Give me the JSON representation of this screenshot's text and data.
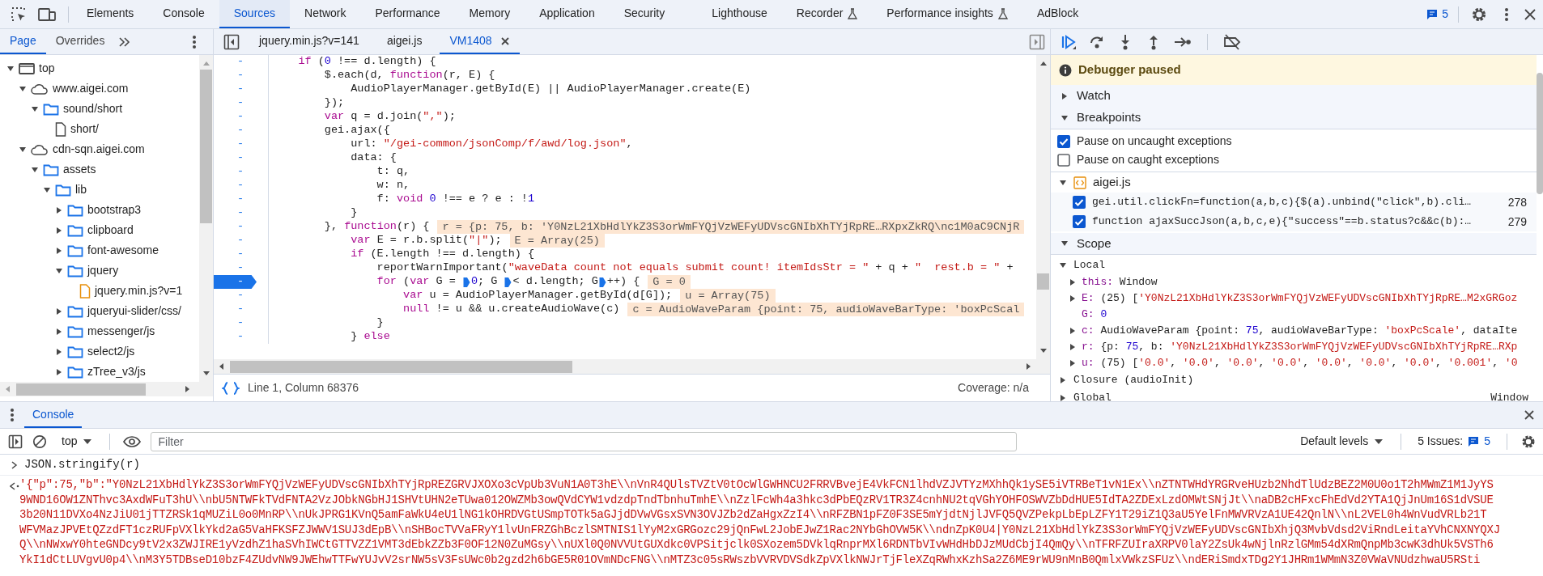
{
  "toolbar": {
    "tabs": [
      {
        "label": "Elements",
        "selected": false,
        "experimental": false
      },
      {
        "label": "Console",
        "selected": false,
        "experimental": false
      },
      {
        "label": "Sources",
        "selected": true,
        "experimental": false
      },
      {
        "label": "Network",
        "selected": false,
        "experimental": false
      },
      {
        "label": "Performance",
        "selected": false,
        "experimental": false
      },
      {
        "label": "Memory",
        "selected": false,
        "experimental": false
      },
      {
        "label": "Application",
        "selected": false,
        "experimental": false
      },
      {
        "label": "Security",
        "selected": false,
        "experimental": false
      },
      {
        "label": "Lighthouse",
        "selected": false,
        "experimental": false
      },
      {
        "label": "Recorder",
        "selected": false,
        "experimental": true
      },
      {
        "label": "Performance insights",
        "selected": false,
        "experimental": true
      },
      {
        "label": "AdBlock",
        "selected": false,
        "experimental": false
      }
    ],
    "issues_count": "5"
  },
  "navigator": {
    "tabs": [
      {
        "label": "Page",
        "selected": true
      },
      {
        "label": "Overrides",
        "selected": false
      }
    ],
    "tree": [
      {
        "label": "top",
        "kind": "frame",
        "expanded": true,
        "children": [
          {
            "label": "www.aigei.com",
            "kind": "domain",
            "expanded": true,
            "children": [
              {
                "label": "sound/short",
                "kind": "folder",
                "expanded": true,
                "children": [
                  {
                    "label": "short/",
                    "kind": "file"
                  }
                ]
              }
            ]
          },
          {
            "label": "cdn-sqn.aigei.com",
            "kind": "domain",
            "expanded": true,
            "children": [
              {
                "label": "assets",
                "kind": "folder",
                "expanded": true,
                "children": [
                  {
                    "label": "lib",
                    "kind": "folder",
                    "expanded": true,
                    "children": [
                      {
                        "label": "bootstrap3",
                        "kind": "folder",
                        "expanded": false
                      },
                      {
                        "label": "clipboard",
                        "kind": "folder",
                        "expanded": false
                      },
                      {
                        "label": "font-awesome",
                        "kind": "folder",
                        "expanded": false
                      },
                      {
                        "label": "jquery",
                        "kind": "folder",
                        "expanded": true,
                        "children": [
                          {
                            "label": "jquery.min.js?v=1",
                            "kind": "script"
                          }
                        ]
                      },
                      {
                        "label": "jqueryui-slider/css/",
                        "kind": "folder",
                        "expanded": false
                      },
                      {
                        "label": "messenger/js",
                        "kind": "folder",
                        "expanded": false
                      },
                      {
                        "label": "select2/js",
                        "kind": "folder",
                        "expanded": false
                      },
                      {
                        "label": "zTree_v3/js",
                        "kind": "folder",
                        "expanded": false
                      }
                    ]
                  }
                ]
              }
            ]
          }
        ]
      }
    ]
  },
  "editor": {
    "tabs": [
      {
        "label": "jquery.min.js?v=141",
        "selected": false,
        "closable": false
      },
      {
        "label": "aigei.js",
        "selected": false,
        "closable": false
      },
      {
        "label": "VM1408",
        "selected": true,
        "closable": true
      }
    ],
    "lines": [
      {
        "number": "-",
        "breakpoint": false,
        "tokens": [
          {
            "kind": "kw",
            "text": "    if"
          },
          {
            "kind": "p",
            "text": " ("
          },
          {
            "kind": "num",
            "text": "0"
          },
          {
            "kind": "p",
            "text": " !== d.length) {"
          }
        ]
      },
      {
        "number": "-",
        "breakpoint": false,
        "tokens": [
          {
            "kind": "p",
            "text": "        $.each(d, "
          },
          {
            "kind": "kw",
            "text": "function"
          },
          {
            "kind": "p",
            "text": "(r, E) {"
          }
        ]
      },
      {
        "number": "-",
        "breakpoint": false,
        "tokens": [
          {
            "kind": "p",
            "text": "            AudioPlayerManager.getById(E) || AudioPlayerManager.create(E)"
          }
        ]
      },
      {
        "number": "-",
        "breakpoint": false,
        "tokens": [
          {
            "kind": "p",
            "text": "        });"
          }
        ]
      },
      {
        "number": "-",
        "breakpoint": false,
        "tokens": [
          {
            "kind": "kw",
            "text": "        var"
          },
          {
            "kind": "p",
            "text": " q = d.join("
          },
          {
            "kind": "str",
            "text": "\",\""
          },
          {
            "kind": "p",
            "text": ");"
          }
        ]
      },
      {
        "number": "-",
        "breakpoint": false,
        "tokens": [
          {
            "kind": "p",
            "text": "        gei.ajax({"
          }
        ]
      },
      {
        "number": "-",
        "breakpoint": false,
        "tokens": [
          {
            "kind": "p",
            "text": "            url: "
          },
          {
            "kind": "str",
            "text": "\"/gei-common/jsonComp/f/awd/log.json\""
          },
          {
            "kind": "p",
            "text": ","
          }
        ]
      },
      {
        "number": "-",
        "breakpoint": false,
        "tokens": [
          {
            "kind": "p",
            "text": "            data: {"
          }
        ]
      },
      {
        "number": "-",
        "breakpoint": false,
        "tokens": [
          {
            "kind": "p",
            "text": "                t: q,"
          }
        ]
      },
      {
        "number": "-",
        "breakpoint": false,
        "tokens": [
          {
            "kind": "p",
            "text": "                w: n,"
          }
        ]
      },
      {
        "number": "-",
        "breakpoint": false,
        "tokens": [
          {
            "kind": "p",
            "text": "                f: "
          },
          {
            "kind": "kw",
            "text": "void"
          },
          {
            "kind": "num",
            "text": " 0"
          },
          {
            "kind": "p",
            "text": " !== e ? e : !"
          },
          {
            "kind": "num",
            "text": "1"
          }
        ]
      },
      {
        "number": "-",
        "breakpoint": false,
        "tokens": [
          {
            "kind": "p",
            "text": "            }"
          }
        ]
      },
      {
        "number": "-",
        "breakpoint": false,
        "tokens": [
          {
            "kind": "p",
            "text": "        }, "
          },
          {
            "kind": "kw",
            "text": "function"
          },
          {
            "kind": "p",
            "text": "(r) {"
          },
          {
            "kind": "val",
            "text": "r = {p: 75, b: 'Y0NzL21XbHdlYkZ3S3orWmFYQjVzWEFyUDVscGNIbXhTYjRpRE…RXpxZkRQ\\nc1M0aC9CNjR"
          }
        ]
      },
      {
        "number": "-",
        "breakpoint": false,
        "tokens": [
          {
            "kind": "kw",
            "text": "            var"
          },
          {
            "kind": "p",
            "text": " E = r.b.split("
          },
          {
            "kind": "str",
            "text": "\"|\""
          },
          {
            "kind": "p",
            "text": ");"
          },
          {
            "kind": "val",
            "text": "E = Array(25)"
          }
        ]
      },
      {
        "number": "-",
        "breakpoint": false,
        "tokens": [
          {
            "kind": "kw",
            "text": "            if"
          },
          {
            "kind": "p",
            "text": " (E.length !== d.length) {"
          }
        ]
      },
      {
        "number": "-",
        "breakpoint": false,
        "tokens": [
          {
            "kind": "p",
            "text": "                reportWarnImportant("
          },
          {
            "kind": "str",
            "text": "\"waveData count not equals submit count! itemIdsStr = \""
          },
          {
            "kind": "p",
            "text": " + q + "
          },
          {
            "kind": "str",
            "text": "\"  rest.b = \""
          },
          {
            "kind": "p",
            "text": " +"
          }
        ]
      },
      {
        "number": "-",
        "breakpoint": true,
        "tokens": [
          {
            "kind": "kw",
            "text": "                for"
          },
          {
            "kind": "p",
            "text": " ("
          },
          {
            "kind": "kw",
            "text": "var"
          },
          {
            "kind": "p",
            "text": " G = "
          },
          {
            "kind": "bp"
          },
          {
            "kind": "num",
            "text": "0"
          },
          {
            "kind": "p",
            "text": "; G "
          },
          {
            "kind": "bp"
          },
          {
            "kind": "p",
            "text": "< d.length; G"
          },
          {
            "kind": "bp"
          },
          {
            "kind": "p",
            "text": "++) {"
          },
          {
            "kind": "val",
            "text": "G = 0"
          }
        ]
      },
      {
        "number": "-",
        "breakpoint": false,
        "tokens": [
          {
            "kind": "kw",
            "text": "                    var"
          },
          {
            "kind": "p",
            "text": " u = AudioPlayerManager.getById(d[G]);"
          },
          {
            "kind": "val",
            "text": "u = Array(75)"
          }
        ]
      },
      {
        "number": "-",
        "breakpoint": false,
        "tokens": [
          {
            "kind": "kw",
            "text": "                    null"
          },
          {
            "kind": "p",
            "text": " != u && u.createAudioWave(c)"
          },
          {
            "kind": "val",
            "text": "c = AudioWaveParam {point: 75, audioWaveBarType: 'boxPcScal"
          }
        ]
      },
      {
        "number": "-",
        "breakpoint": false,
        "tokens": [
          {
            "kind": "p",
            "text": "                }"
          }
        ]
      },
      {
        "number": "-",
        "breakpoint": false,
        "tokens": [
          {
            "kind": "p",
            "text": "            } "
          },
          {
            "kind": "kw",
            "text": "else"
          }
        ]
      }
    ],
    "status": "Line 1, Column 68376",
    "coverage": "Coverage: n/a"
  },
  "debugger": {
    "banner": "Debugger paused",
    "watch": {
      "label": "Watch",
      "expanded": false
    },
    "breakpoints": {
      "label": "Breakpoints",
      "expanded": true,
      "options": [
        {
          "label": "Pause on uncaught exceptions",
          "checked": true
        },
        {
          "label": "Pause on caught exceptions",
          "checked": false
        }
      ],
      "files": [
        {
          "name": "aigei.js",
          "expanded": true,
          "items": [
            {
              "code": "gei.util.clickFn=function(a,b,c){$(a).unbind(\"click\",b).cli…",
              "line": "278",
              "checked": true
            },
            {
              "code": "function ajaxSuccJson(a,b,c,e){\"success\"==b.status?c&&c(b):…",
              "line": "279",
              "checked": true
            }
          ]
        }
      ]
    },
    "scope": {
      "label": "Scope",
      "expanded": true,
      "groups": [
        {
          "label": "Local",
          "expanded": true,
          "vars": [
            {
              "name": "this:",
              "expandable": true,
              "tokens": [
                {
                  "kind": "p",
                  "text": "Window"
                }
              ]
            },
            {
              "name": "E:",
              "expandable": true,
              "tokens": [
                {
                  "kind": "p",
                  "text": "(25) ["
                },
                {
                  "kind": "str",
                  "text": "'Y0NzL21XbHdlYkZ3S3orWmFYQjVzWEFyUDVscGNIbXhTYjRpRE…M2xGRGoz"
                }
              ]
            },
            {
              "name": "G:",
              "expandable": false,
              "tokens": [
                {
                  "kind": "num",
                  "text": "0"
                }
              ]
            },
            {
              "name": "c:",
              "expandable": true,
              "tokens": [
                {
                  "kind": "p",
                  "text": "AudioWaveParam {point: "
                },
                {
                  "kind": "num",
                  "text": "75"
                },
                {
                  "kind": "p",
                  "text": ", audioWaveBarType: "
                },
                {
                  "kind": "str",
                  "text": "'boxPcScale'"
                },
                {
                  "kind": "p",
                  "text": ", dataIte"
                }
              ]
            },
            {
              "name": "r:",
              "expandable": true,
              "tokens": [
                {
                  "kind": "p",
                  "text": "{p: "
                },
                {
                  "kind": "num",
                  "text": "75"
                },
                {
                  "kind": "p",
                  "text": ", b: "
                },
                {
                  "kind": "str",
                  "text": "'Y0NzL21XbHdlYkZ3S3orWmFYQjVzWEFyUDVscGNIbXhTYjRpRE…RXp"
                }
              ]
            },
            {
              "name": "u:",
              "expandable": true,
              "tokens": [
                {
                  "kind": "p",
                  "text": "(75) ["
                },
                {
                  "kind": "str",
                  "text": "'0.0'"
                },
                {
                  "kind": "p",
                  "text": ", "
                },
                {
                  "kind": "str",
                  "text": "'0.0'"
                },
                {
                  "kind": "p",
                  "text": ", "
                },
                {
                  "kind": "str",
                  "text": "'0.0'"
                },
                {
                  "kind": "p",
                  "text": ", "
                },
                {
                  "kind": "str",
                  "text": "'0.0'"
                },
                {
                  "kind": "p",
                  "text": ", "
                },
                {
                  "kind": "str",
                  "text": "'0.0'"
                },
                {
                  "kind": "p",
                  "text": ", "
                },
                {
                  "kind": "str",
                  "text": "'0.0'"
                },
                {
                  "kind": "p",
                  "text": ", "
                },
                {
                  "kind": "str",
                  "text": "'0.0'"
                },
                {
                  "kind": "p",
                  "text": ", "
                },
                {
                  "kind": "str",
                  "text": "'0.001'"
                },
                {
                  "kind": "p",
                  "text": ", "
                },
                {
                  "kind": "str",
                  "text": "'0"
                }
              ]
            }
          ]
        },
        {
          "label": "Closure (audioInit)",
          "expanded": false
        },
        {
          "label": "Global",
          "expanded": false,
          "value": "Window"
        }
      ]
    }
  },
  "console": {
    "tab": {
      "label": "Console",
      "selected": true
    },
    "context": "top",
    "filter_placeholder": "Filter",
    "levels": "Default levels",
    "issues_label": "5 Issues:",
    "issues_count": "5",
    "input": "JSON.stringify(r)",
    "output": [
      "'{\"p\":75,\"b\":\"Y0NzL21XbHdlYkZ3S3orWmFYQjVzWEFyUDVscGNIbXhTYjRpREZGRVJXOXo3cVpUb3VuN1A0T3hE\\\\nVnR4QUlsTVZtV0tOcWlGWHNCU2FRRVBvejE4VkFCN1lhdVZJVTYzMXhhQk1ySE5iVTRBeT1vN1Ex\\\\nZTNTWHdYRGRveHUzb2NhdTlUdzBEZ2M0U0o1T2hMWmZ1M1JyYS",
      "9WND16OW1ZNThvc3AxdWFuT3hU\\\\nbU5NTWFkTVdFNTA2VzJObkNGbHJ1SHVtUHN2eTUwa012OWZMb3owQVdCYW1vdzdpTndTbnhuTmhE\\\\nZzlFcWh4a3hkc3dPbEQzRV1TR3Z4cnhNU2tqVGhYOHFOSWVZbDdHUE5IdTA2ZDExLzdOMWtSNjJt\\\\naDB2cHFxcFhEdVd2YTA1QjJnUm16S1dVSUE",
      "3b20N11DVXo4NzJiU01jTTZRSk1qMUZiL0o0MnRP\\\\nUkJPRG1KVnQ5amFaWkU4eU1lNG1kOHRDVGtUSmpTOTk5aGJjdDVwVGsxSVN3OVJZb2dZaHgxZzI4\\\\nRFZBN1pFZ0F3SE5mYjdtNjlJVFQ5QVZPekpLbEpLZFY1T29iZ1Q3aU5YelFnMWVRVzA1UE42QnlN\\\\nL2VEL0h4WnVudVRLb21T",
      "WFVMazJPVEtQZzdFT1czRUFpVXlkYkd2aG5VaHFKSFZJWWV1SUJ3dEpB\\\\nSHBocTVVaFRyY1lvUnFRZGhBczlSMTNIS1lYyM2xGRGozc29jQnFwL2JobEJwZ1Rac2NYbGhOVW5K\\\\ndnZpK0U4|Y0NzL21XbHdlYkZ3S3orWmFYQjVzWEFyUDVscGNIbXhjQ3MvbVdsd2ViRndLeitaYVhCNXNYQXJ",
      "Q\\\\nNWxwY0hteGNDcy9tV2x3ZWJIRE1yVzdhZ1haSVhIWCtGTTVZZ1VMT3dEbkZZb3F0OF12N0ZuMGsy\\\\nUXl0Q0NVVUtGUXdkc0VPSitjclk0SXozem5DVklqRnprMXl6RDNTbVIvWHdHbDJzMUdCbjI4QmQy\\\\nTFRFZUIraXRPV0laY2ZsUk4wNjlnRzlGMm54dXRmQnpMb3cwK3dhUk5VSTh6",
      "YkI1dCtLUVgvU0p4\\\\nM3Y5TDBseD10bzF4ZUdvNW9JWEhwTTFwYUJvV2srNW5sV3FsUWc0b2gzd2h6bGE5R01OVmNDcFNG\\\\nMTZ3c05sRWszbVVRVDVSdkZpVXlkNWJrTjFleXZqRWhxKzhSa2Z6ME9rWU9nMnB0QmlxVWkzSFUz\\\\ndERiSmdxTDg2Y1JHRm1WMmN3Z0VWaVNUdzhwaU5RSti"
    ]
  }
}
